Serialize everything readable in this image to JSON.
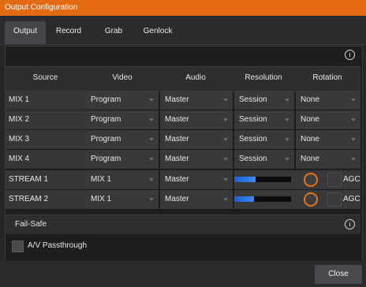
{
  "window": {
    "title": "Output Configuration"
  },
  "tabs": [
    "Output",
    "Record",
    "Grab",
    "Genlock"
  ],
  "active_tab": "Output",
  "table": {
    "headers": [
      "Source",
      "Video",
      "Audio",
      "Resolution",
      "Rotation"
    ],
    "rows": [
      {
        "source": "MIX 1",
        "video": "Program",
        "audio": "Master",
        "resolution": "Session",
        "rotation": "None"
      },
      {
        "source": "MIX 2",
        "video": "Program",
        "audio": "Master",
        "resolution": "Session",
        "rotation": "None"
      },
      {
        "source": "MIX 3",
        "video": "Program",
        "audio": "Master",
        "resolution": "Session",
        "rotation": "None"
      },
      {
        "source": "MIX 4",
        "video": "Program",
        "audio": "Master",
        "resolution": "Session",
        "rotation": "None"
      },
      {
        "source": "STREAM 1",
        "video": "MIX 1",
        "audio": "Master",
        "level": 0.38,
        "agc": "AGC"
      },
      {
        "source": "STREAM 2",
        "video": "MIX 1",
        "audio": "Master",
        "level": 0.35,
        "agc": "AGC"
      }
    ]
  },
  "failsafe": {
    "label": "Fail-Safe",
    "checkbox_label": "A/V Passthrough"
  },
  "buttons": {
    "close": "Close"
  },
  "info_glyph": "i",
  "colors": {
    "titlebar": "#e36a12",
    "accent_orange": "#e2731d",
    "meter_blue": "#2f7ae8"
  }
}
